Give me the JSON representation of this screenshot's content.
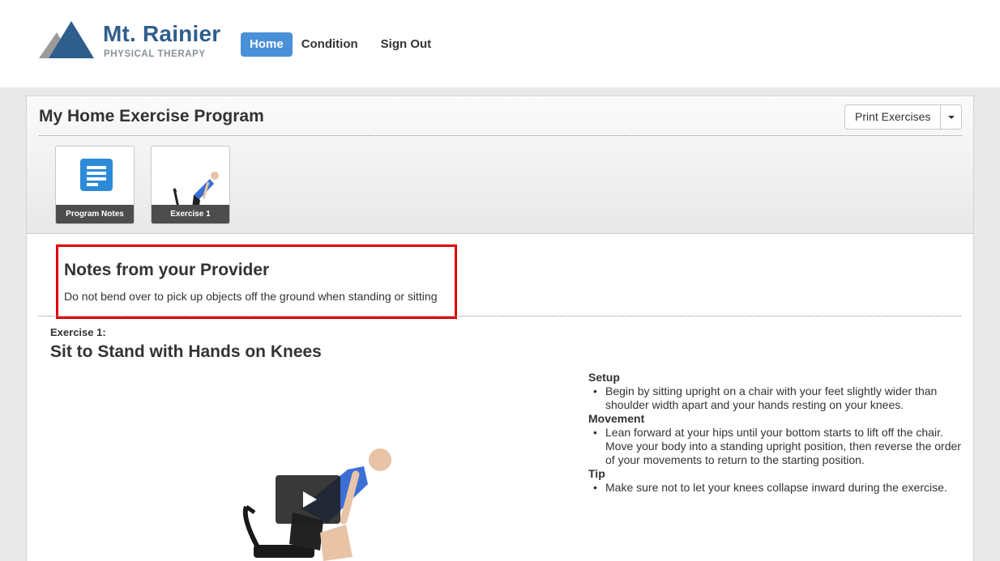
{
  "brand": {
    "name": "Mt. Rainier",
    "subtitle": "PHYSICAL THERAPY",
    "colors": {
      "primary": "#2e5e8c",
      "accent": "#4a90d9",
      "mountain_gray": "#9a9a9a"
    }
  },
  "nav": {
    "items": [
      {
        "label": "Home",
        "active": true
      },
      {
        "label": "Condition",
        "active": false
      },
      {
        "label": "Sign Out",
        "active": false
      }
    ]
  },
  "program": {
    "title": "My Home Exercise Program",
    "print_label": "Print Exercises",
    "thumbnails": [
      {
        "label": "Program Notes",
        "icon": "document-icon"
      },
      {
        "label": "Exercise 1",
        "icon": "exercise-figure"
      }
    ]
  },
  "notes": {
    "title": "Notes from your Provider",
    "text": "Do not bend over to pick up objects off the ground when standing or sitting",
    "highlight_color": "#e00000"
  },
  "exercise": {
    "label": "Exercise 1:",
    "title": "Sit to Stand with Hands on Knees",
    "sections": [
      {
        "heading": "Setup",
        "items": [
          "Begin by sitting upright on a chair with your feet slightly wider than shoulder width apart and your hands resting on your knees."
        ]
      },
      {
        "heading": "Movement",
        "items": [
          "Lean forward at your hips until your bottom starts to lift off the chair. Move your body into a standing upright position, then reverse the order of your movements to return to the starting position."
        ]
      },
      {
        "heading": "Tip",
        "items": [
          "Make sure not to let your knees collapse inward during the exercise."
        ]
      }
    ]
  }
}
